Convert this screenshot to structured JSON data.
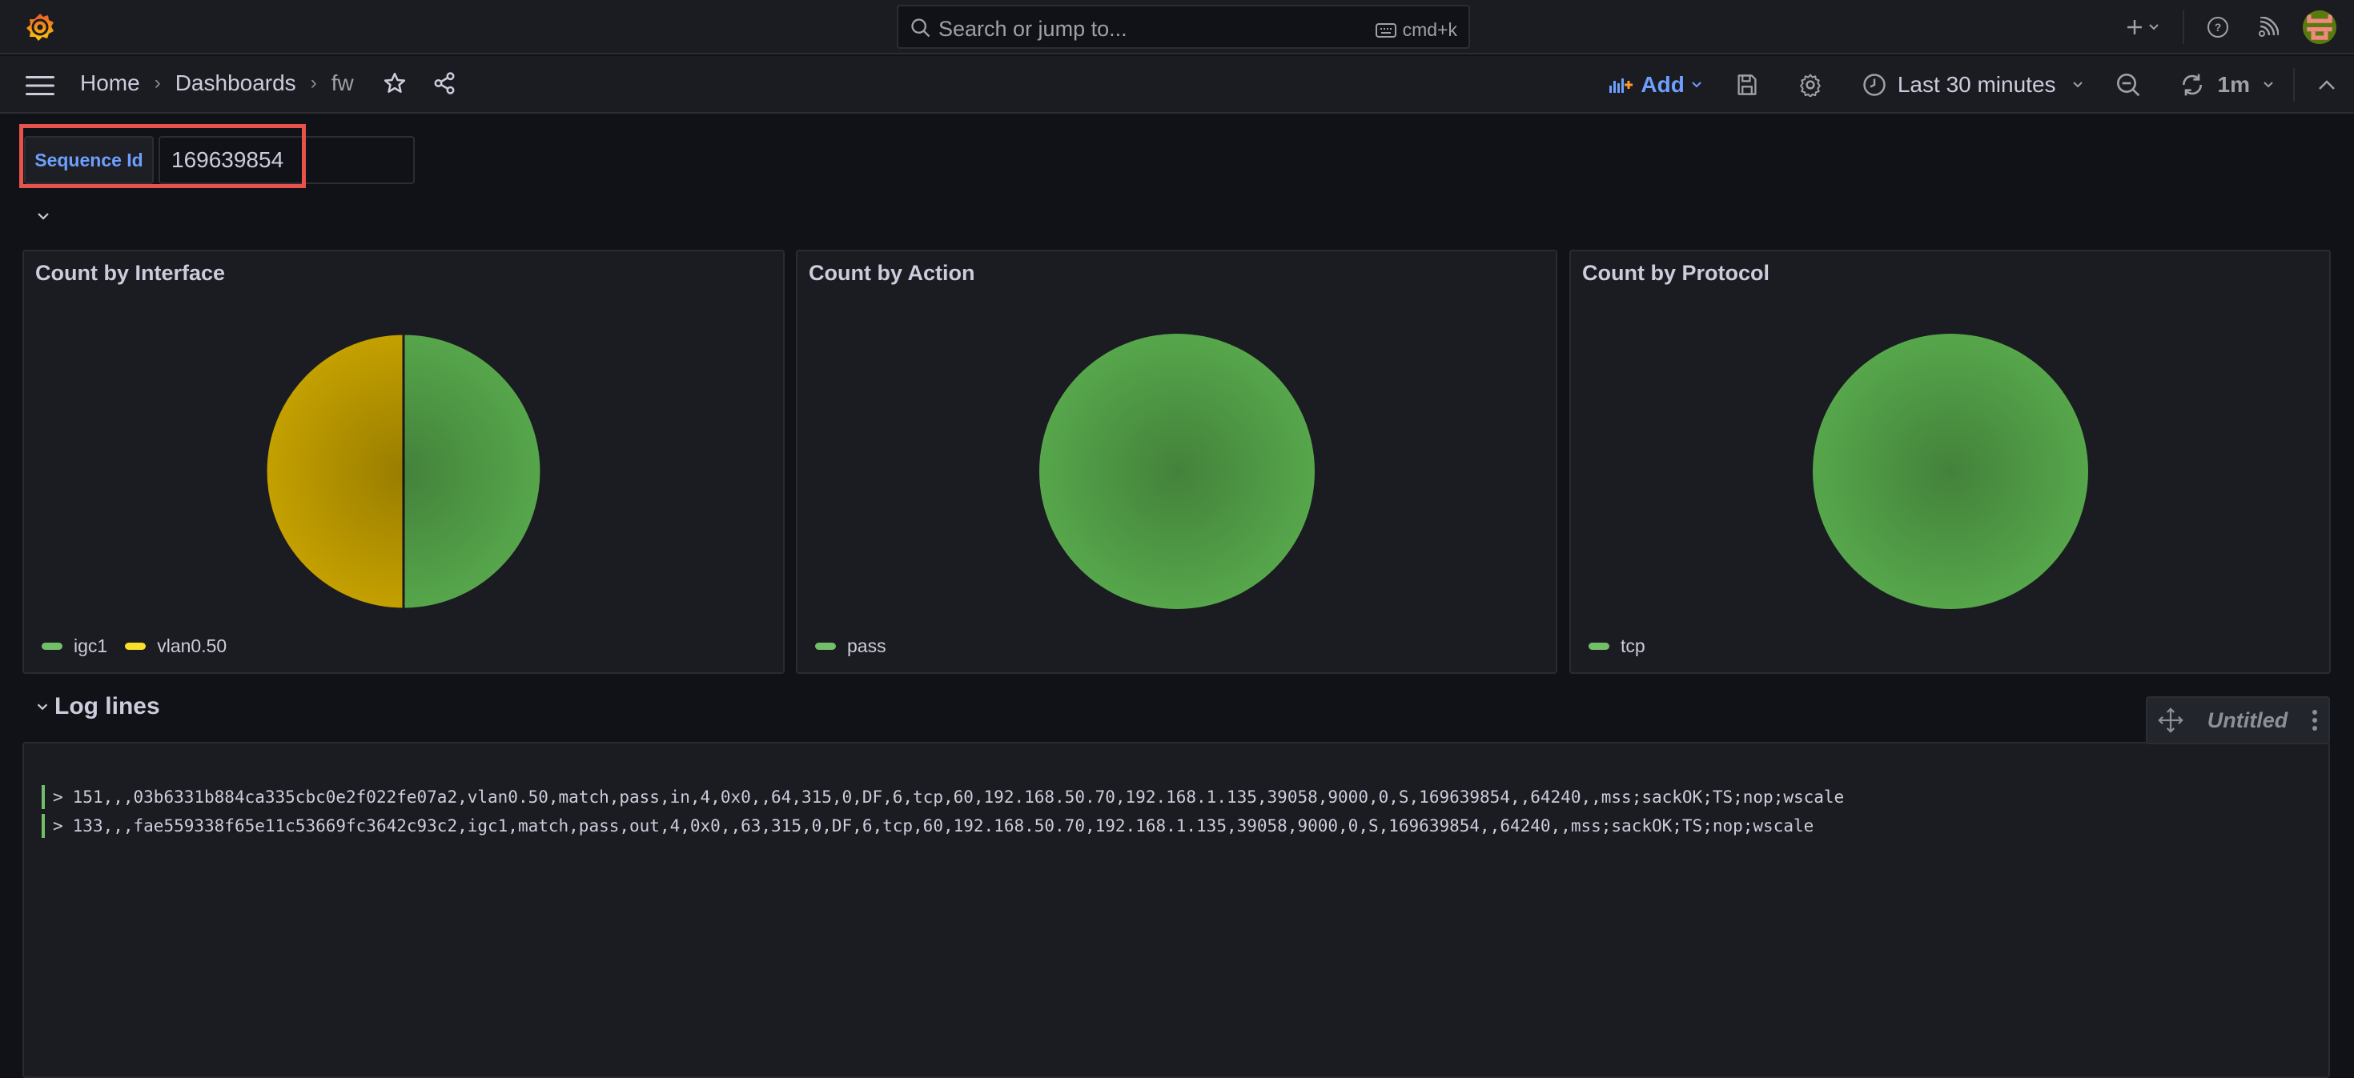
{
  "topbar": {
    "search_placeholder": "Search or jump to...",
    "search_shortcut": "cmd+k",
    "icons": [
      "grafana-logo-icon",
      "search-icon",
      "keyboard-icon",
      "plus-icon",
      "help-icon",
      "news-rss-icon",
      "user-avatar"
    ]
  },
  "navbar": {
    "breadcrumb": [
      "Home",
      "Dashboards",
      "fw"
    ],
    "add_label": "Add",
    "time_range": "Last 30 minutes",
    "refresh_interval": "1m"
  },
  "variables": {
    "sequence_id_label": "Sequence Id",
    "sequence_id_value": "169639854"
  },
  "colors": {
    "green": "#56a64b",
    "yellow": "#c4a000",
    "legend_green": "#73bf69",
    "legend_yellow": "#fade2a",
    "accent_blue": "#6e9fff",
    "highlight_red": "#e5534b"
  },
  "chart_data": [
    {
      "type": "pie",
      "title": "Count by Interface",
      "categories": [
        "igc1",
        "vlan0.50"
      ],
      "values": [
        1,
        1
      ],
      "colors": [
        "#56a64b",
        "#c4a000"
      ],
      "legend_colors": [
        "#73bf69",
        "#fade2a"
      ],
      "legend": "bottom-left"
    },
    {
      "type": "pie",
      "title": "Count by Action",
      "categories": [
        "pass"
      ],
      "values": [
        2
      ],
      "colors": [
        "#56a64b"
      ],
      "legend_colors": [
        "#73bf69"
      ],
      "legend": "bottom-left"
    },
    {
      "type": "pie",
      "title": "Count by Protocol",
      "categories": [
        "tcp"
      ],
      "values": [
        2
      ],
      "colors": [
        "#56a64b"
      ],
      "legend_colors": [
        "#73bf69"
      ],
      "legend": "bottom-left"
    }
  ],
  "log_row": {
    "title": "Log lines",
    "panel_title": "Untitled",
    "lines": [
      "151,,,03b6331b884ca335cbc0e2f022fe07a2,vlan0.50,match,pass,in,4,0x0,,64,315,0,DF,6,tcp,60,192.168.50.70,192.168.1.135,39058,9000,0,S,169639854,,64240,,mss;sackOK;TS;nop;wscale",
      "133,,,fae559338f65e11c53669fc3642c93c2,igc1,match,pass,out,4,0x0,,63,315,0,DF,6,tcp,60,192.168.50.70,192.168.1.135,39058,9000,0,S,169639854,,64240,,mss;sackOK;TS;nop;wscale"
    ]
  }
}
